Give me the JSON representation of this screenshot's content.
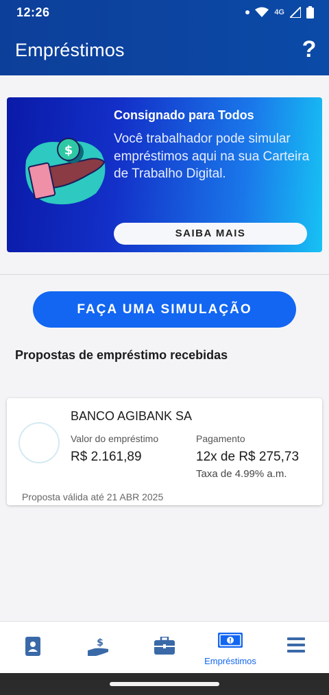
{
  "status": {
    "time": "12:26",
    "network": "4G",
    "icons": [
      "notification-dot-icon",
      "wifi-icon",
      "signal-icon",
      "battery-icon"
    ]
  },
  "header": {
    "title": "Empréstimos",
    "help_icon": "help-icon",
    "help_label": "?"
  },
  "banner": {
    "title": "Consignado para Todos",
    "text": "Você trabalhador pode simular empréstimos aqui na sua Carteira de Trabalho Digital.",
    "button": "SAIBA MAIS"
  },
  "simulate_button": "FAÇA UMA SIMULAÇÃO",
  "section_title": "Propostas de empréstimo recebidas",
  "proposals": [
    {
      "bank": "BANCO AGIBANK SA",
      "amount_label": "Valor do empréstimo",
      "amount": "R$ 2.161,89",
      "payment_label": "Pagamento",
      "payment": "12x de R$ 275,73",
      "rate": "Taxa de 4.99% a.m.",
      "validity": "Proposta válida até 21 ABR 2025"
    }
  ],
  "bottom_nav": [
    {
      "icon": "id-card-icon",
      "label": ""
    },
    {
      "icon": "money-hand-icon",
      "label": ""
    },
    {
      "icon": "briefcase-icon",
      "label": ""
    },
    {
      "icon": "banknote-icon",
      "label": "Empréstimos"
    },
    {
      "icon": "menu-icon",
      "label": ""
    }
  ],
  "colors": {
    "header": "#0b4aa7",
    "primary": "#1266f1",
    "banner_start": "#0a1aa8",
    "banner_end": "#17c2f4",
    "nav_icon": "#3a69a8"
  }
}
